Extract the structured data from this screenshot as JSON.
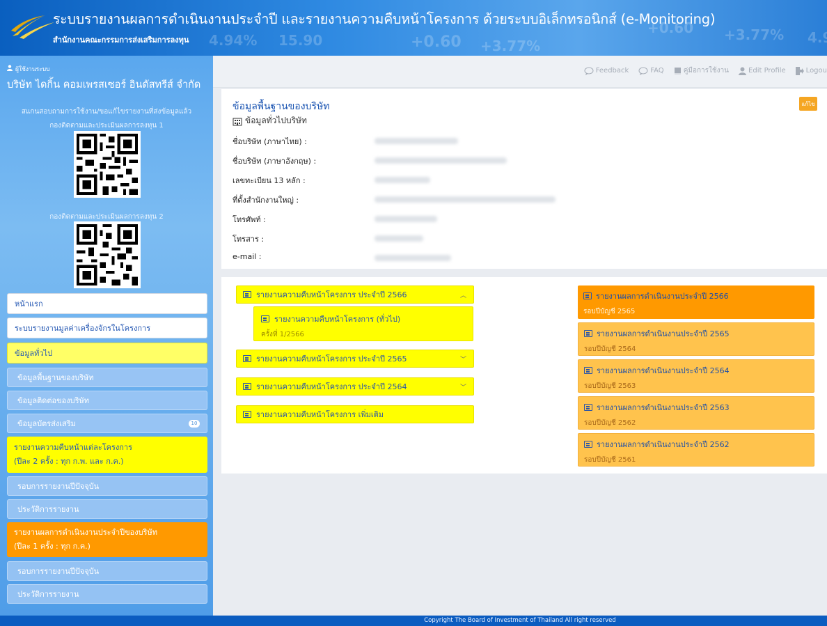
{
  "header": {
    "title": "ระบบรายงานผลการดำเนินงานประจำปี และรายงานความคืบหน้าโครงการ ด้วยระบบอิเล็กทรอนิกส์ (e-Monitoring)",
    "subtitle": "สำนักงานคณะกรรมการส่งเสริมการลงทุน",
    "tickers": [
      "4.94%",
      "15.90",
      "+0.60",
      "+3.77%",
      "+0.60",
      "+3.77%",
      "4.9"
    ]
  },
  "sidebar": {
    "role": "ผู้ใช้งานระบบ",
    "company": "บริษัท ไดกิ้น คอมเพรสเซอร์ อินดัสทรีส์ จำกัด",
    "qr_intro": "สแกนสอบถามการใช้งาน/ขอแก้ไขรายงานที่ส่งข้อมูลแล้ว",
    "qr1_label": "กองติดตามและประเมินผลการลงทุน 1",
    "qr2_label": "กองติดตามและประเมินผลการลงทุน 2",
    "menu": {
      "home": "หน้าแรก",
      "machine": "ระบบรายงานมูลค่าเครื่องจักรในโครงการ",
      "general": "ข้อมูลทั่วไป",
      "basic": "ข้อมูลพื้นฐานของบริษัท",
      "contact": "ข้อมูลติดต่อของบริษัท",
      "promo": "ข้อมูลบัตรส่งเสริม",
      "promo_badge": "10",
      "progress_title": "รายงานความคืบหน้าแต่ละโครงการ",
      "progress_note": "(ปีละ 2 ครั้ง : ทุก ก.พ. และ ก.ค.)",
      "current_round_1": "รอบการรายงานปีปัจจุบัน",
      "history_1": "ประวัติการรายงาน",
      "annual_title": "รายงานผลการดำเนินงานประจำปีของบริษัท",
      "annual_note": "(ปีละ 1 ครั้ง : ทุก ก.ค.)",
      "current_round_2": "รอบการรายงานปีปัจจุบัน",
      "history_2": "ประวัติการรายงาน"
    }
  },
  "toolbar": {
    "feedback": "Feedback",
    "faq": "FAQ",
    "manual": "คู่มือการใช้งาน",
    "edit_profile": "Edit Profile",
    "logout": "Logou"
  },
  "info": {
    "title": "ข้อมูลพื้นฐานของบริษัท",
    "subtitle": "ข้อมูลทั่วไปบริษัท",
    "edit": "แก้ไข",
    "fields": [
      "ชื่อบริษัท (ภาษาไทย) :",
      "ชื่อบริษัท (ภาษาอังกฤษ) :",
      "เลขทะเบียน 13 หลัก :",
      "ที่ตั้งสำนักงานใหญ่ :",
      "โทรศัพท์ :",
      "โทรสาร :",
      "e-mail :"
    ]
  },
  "reports": {
    "progress": {
      "y2566": "รายงานความคืบหน้าโครงการ ประจำปี 2566",
      "general_title": "รายงานความคืบหน้าโครงการ (ทั่วไป)",
      "general_round": "ครั้งที่ 1/2566",
      "y2565": "รายงานความคืบหน้าโครงการ ประจำปี 2565",
      "y2564": "รายงานความคืบหน้าโครงการ ประจำปี 2564",
      "extra": "รายงานความคืบหน้าโครงการ เพิ่มเติม"
    },
    "annual": [
      {
        "title": "รายงานผลการดำเนินงานประจำปี 2566",
        "round": "รอบปีบัญชี 2565"
      },
      {
        "title": "รายงานผลการดำเนินงานประจำปี 2565",
        "round": "รอบปีบัญชี 2564"
      },
      {
        "title": "รายงานผลการดำเนินงานประจำปี 2564",
        "round": "รอบปีบัญชี 2563"
      },
      {
        "title": "รายงานผลการดำเนินงานประจำปี 2563",
        "round": "รอบปีบัญชี 2562"
      },
      {
        "title": "รายงานผลการดำเนินงานประจำปี 2562",
        "round": "รอบปีบัญชี 2561"
      }
    ]
  },
  "footer": {
    "copyright": "Copyright The Board of Investment of Thailand All right reserved"
  },
  "colors": {
    "header_blue": "#0a5fbf",
    "sidebar_blue": "#5aa7ee",
    "yellow": "#ffff00",
    "orange": "#ff9900",
    "light_orange": "#ffc34d",
    "link_blue": "#1e57b3"
  }
}
